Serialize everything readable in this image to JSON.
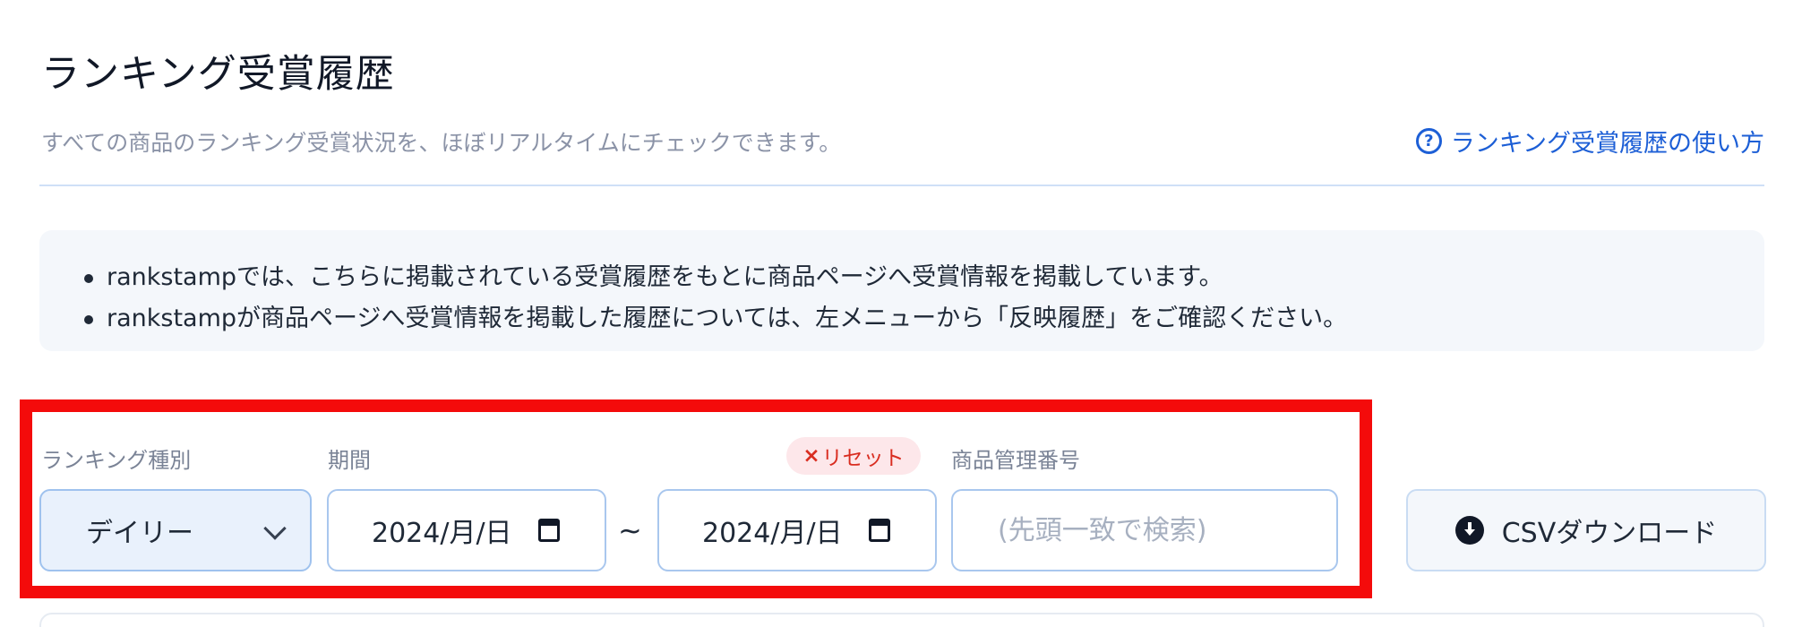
{
  "header": {
    "title": "ランキング受賞履歴",
    "subtitle": "すべての商品のランキング受賞状況を、ほぼリアルタイムにチェックできます。",
    "help_link": "ランキング受賞履歴の使い方",
    "help_icon": "?"
  },
  "notice": {
    "items": [
      "rankstampでは、こちらに掲載されている受賞履歴をもとに商品ページへ受賞情報を掲載しています。",
      "rankstampが商品ページへ受賞情報を掲載した履歴については、左メニューから「反映履歴」をご確認ください。"
    ]
  },
  "filters": {
    "ranking_type_label": "ランキング種別",
    "ranking_type_value": "デイリー",
    "period_label": "期間",
    "reset_x": "×",
    "reset_label": "リセット",
    "date_from": "2024/月/日",
    "date_to": "2024/月/日",
    "range_separator": "~",
    "code_label": "商品管理番号",
    "code_placeholder": "(先頭一致で検索)",
    "code_value": ""
  },
  "actions": {
    "csv_download": "CSVダウンロード"
  },
  "colors": {
    "accent": "#1d5fd6",
    "highlight_border": "#f40b0b",
    "reset_text": "#d92d20"
  }
}
